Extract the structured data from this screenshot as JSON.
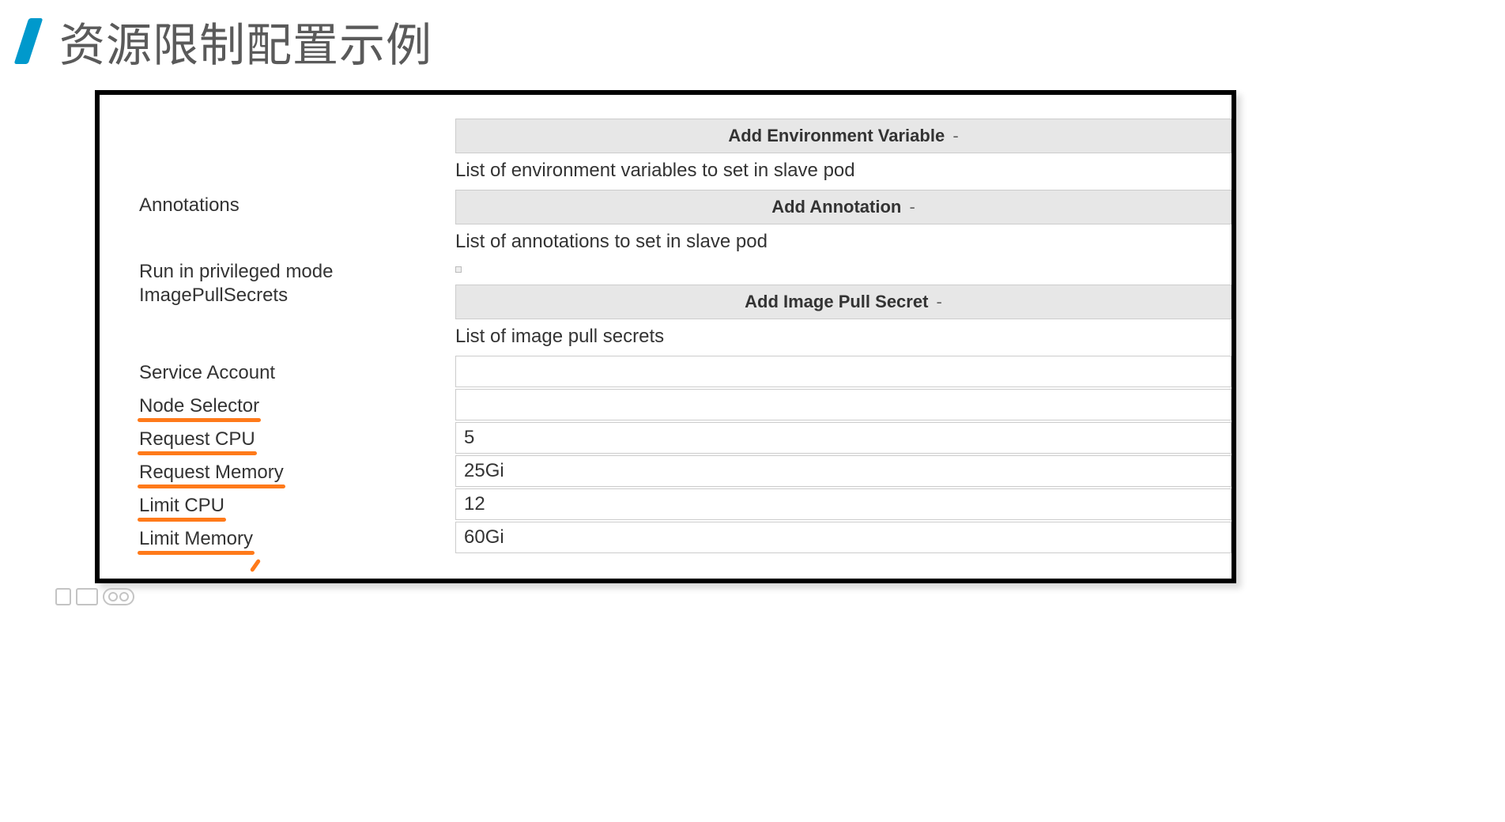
{
  "title": "资源限制配置示例",
  "form": {
    "envVariables": {
      "buttonLabel": "Add Environment Variable",
      "helper": "List of environment variables to set in slave pod"
    },
    "annotations": {
      "label": "Annotations",
      "buttonLabel": "Add Annotation",
      "helper": "List of annotations to set in slave pod"
    },
    "privileged": {
      "label": "Run in privileged mode",
      "checked": false
    },
    "imagePullSecrets": {
      "label": "ImagePullSecrets",
      "buttonLabel": "Add Image Pull Secret",
      "helper": "List of image pull secrets"
    },
    "serviceAccount": {
      "label": "Service Account",
      "value": ""
    },
    "nodeSelector": {
      "label": "Node Selector",
      "value": ""
    },
    "requestCpu": {
      "label": "Request CPU",
      "value": "5"
    },
    "requestMemory": {
      "label": "Request Memory",
      "value": "25Gi"
    },
    "limitCpu": {
      "label": "Limit CPU",
      "value": "12"
    },
    "limitMemory": {
      "label": "Limit Memory",
      "value": "60Gi"
    }
  }
}
